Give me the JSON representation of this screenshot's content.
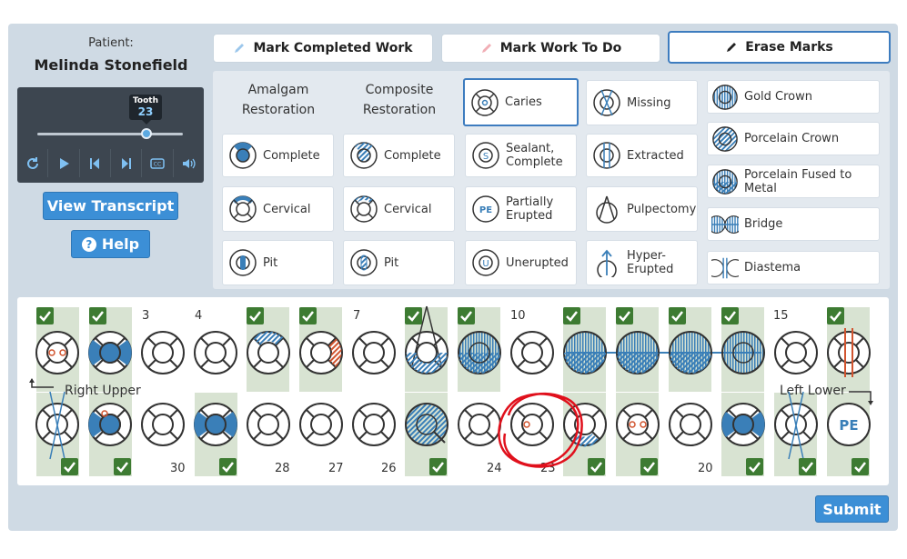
{
  "patient": {
    "label": "Patient:",
    "name": "Melinda Stonefield"
  },
  "player": {
    "tooltip_label": "Tooth",
    "tooltip_value": "23",
    "progress": 0.82,
    "controls": [
      "replay-icon",
      "play-icon",
      "skip-back-icon",
      "skip-forward-icon",
      "captions-icon",
      "volume-icon"
    ]
  },
  "buttons": {
    "transcript": "View Transcript",
    "help": "Help",
    "submit": "Submit"
  },
  "tabs": [
    {
      "label": "Mark Completed Work",
      "icon_color": "#9cc7ec"
    },
    {
      "label": "Mark Work To Do",
      "icon_color": "#f1aeb5"
    },
    {
      "label": "Erase Marks",
      "icon_color": "#222222"
    }
  ],
  "columns": {
    "amalgam": "Amalgam Restoration",
    "composite": "Composite Restoration"
  },
  "options": {
    "amalgam": [
      "Complete",
      "Cervical",
      "Pit"
    ],
    "composite": [
      "Complete",
      "Cervical",
      "Pit"
    ],
    "col3": [
      "Caries",
      "Sealant, Complete",
      "Partially Erupted",
      "Unerupted"
    ],
    "col4": [
      "Missing",
      "Extracted",
      "Pulpectomy",
      "Hyper-Erupted"
    ],
    "col5": [
      "Gold Crown",
      "Porcelain Crown",
      "Porcelain Fused to Metal",
      "Bridge",
      "Diastema"
    ]
  },
  "chart": {
    "upper_numbers": [
      "3",
      "4",
      "7",
      "10",
      "15"
    ],
    "lower_numbers": [
      "30",
      "28",
      "27",
      "26",
      "24",
      "23",
      "20"
    ],
    "label_right_upper": "Right Upper",
    "label_left_lower": "Left Lower",
    "badge_pe": "PE"
  },
  "colors": {
    "accent": "#3c8fd6",
    "check": "#3d7b32",
    "highlight": "#d8e3d2",
    "restoration": "#3a7fb8",
    "caries": "#d1542f",
    "annotation": "#e0101c"
  }
}
